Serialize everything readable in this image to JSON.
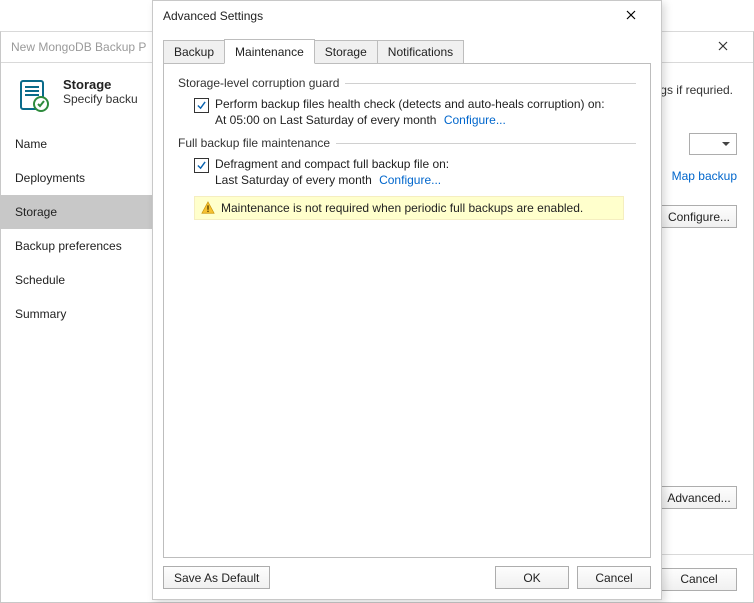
{
  "bg": {
    "title": "New MongoDB Backup P",
    "header_title": "Storage",
    "header_sub": "Specify backu",
    "truncated_right": "gs if requried.",
    "nav": [
      "Name",
      "Deployments",
      "Storage",
      "Backup preferences",
      "Schedule",
      "Summary"
    ],
    "map_link": "Map backup",
    "configure_btn": "Configure...",
    "advanced_btn": "Advanced...",
    "cancel_btn": "Cancel"
  },
  "fg": {
    "title": "Advanced Settings",
    "tabs": [
      "Backup",
      "Maintenance",
      "Storage",
      "Notifications"
    ],
    "group1": {
      "title": "Storage-level corruption guard",
      "check_label": "Perform backup files health check (detects and auto-heals corruption) on:",
      "schedule": "At 05:00 on Last Saturday of every month",
      "configure": "Configure..."
    },
    "group2": {
      "title": "Full backup file maintenance",
      "check_label": "Defragment and compact full backup file on:",
      "schedule": "Last Saturday of every month",
      "configure": "Configure..."
    },
    "notice": "Maintenance is not required when periodic full backups are enabled.",
    "save_default": "Save As Default",
    "ok": "OK",
    "cancel": "Cancel"
  }
}
